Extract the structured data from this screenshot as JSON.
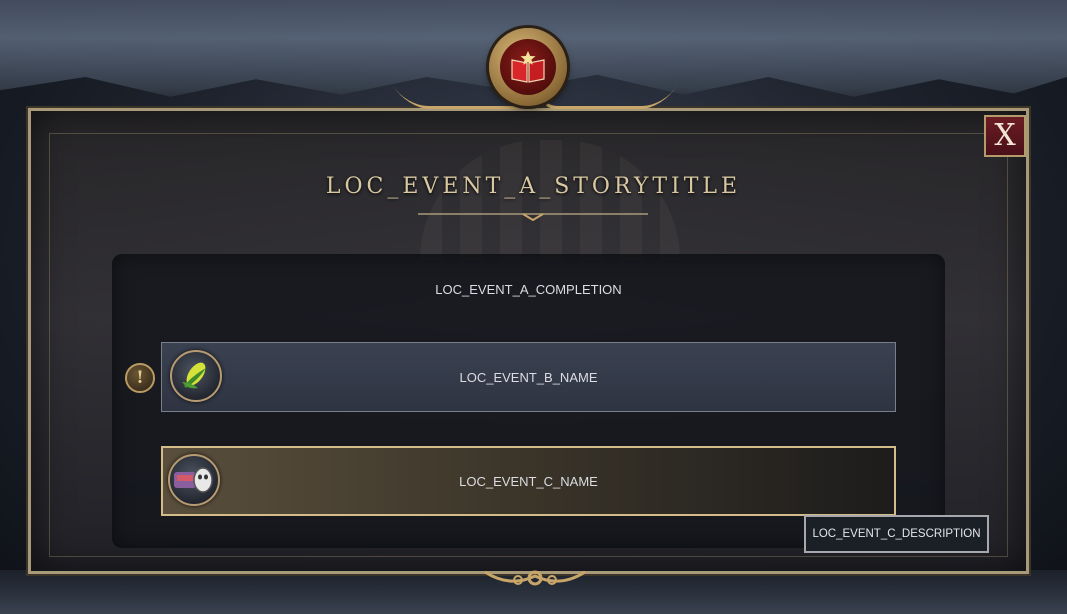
{
  "dialog": {
    "title": "LOC_EVENT_A_STORYTITLE",
    "close_label": "X",
    "completion_text": "LOC_EVENT_A_COMPLETION",
    "header_icon": "red-book-star-icon",
    "choices": [
      {
        "label": "LOC_EVENT_B_NAME",
        "icon": "corn-icon",
        "marker_icon": "exclamation-icon",
        "marker_text": "!"
      },
      {
        "label": "LOC_EVENT_C_NAME",
        "icon": "mask-and-scene-icon",
        "selected": true
      }
    ],
    "tooltip": "LOC_EVENT_C_DESCRIPTION"
  },
  "colors": {
    "frame_gold": "#a89a78",
    "close_red": "#6b1c24",
    "selected_border": "#d4bb8a",
    "title_text": "#d8c8a2"
  }
}
